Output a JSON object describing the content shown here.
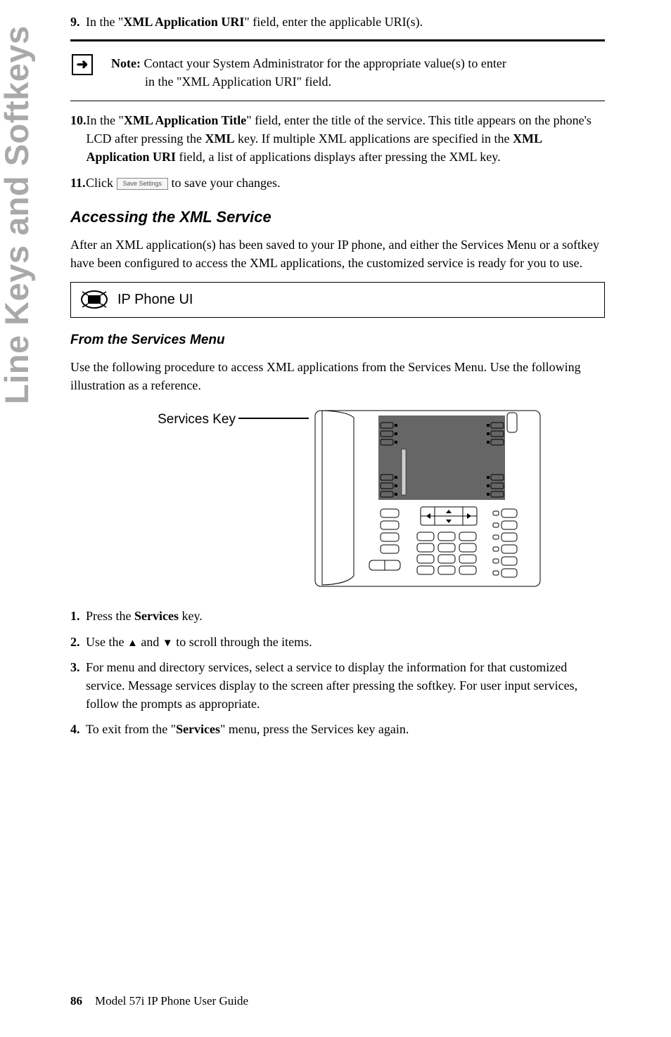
{
  "sidebar": "Line Keys and Softkeys",
  "step9": {
    "num": "9.",
    "text_pre": "In the \"",
    "bold1": "XML Application URI",
    "text_post": "\" field, enter the applicable URI(s)."
  },
  "note": {
    "label": "Note:",
    "line1": " Contact your System Administrator for the appropriate value(s) to enter",
    "line2": "in the \"XML Application URI\" field."
  },
  "step10": {
    "num": "10.",
    "t1": "In the \"",
    "b1": "XML Application Title",
    "t2": "\" field, enter the title of the service. This title appears on the phone's LCD after pressing the ",
    "b2": "XML",
    "t3": " key. If multiple XML applications are specified in the ",
    "b3": "XML Application URI",
    "t4": " field, a list of applications displays after pressing the XML key."
  },
  "step11": {
    "num": "11.",
    "t1": "Click ",
    "btn": "Save Settings",
    "t2": " to save your changes."
  },
  "h_access": "Accessing the XML Service",
  "p_access": "After an XML application(s) has been saved to your IP phone, and either the Services Menu or a softkey have been configured to access the XML applications, the customized service is ready for you to use.",
  "ui_box": "IP Phone UI",
  "h_services": "From the Services Menu",
  "p_services": "Use the following procedure to access XML applications from the Services Menu. Use the following illustration as a reference.",
  "fig_label": "Services Key",
  "list": {
    "i1": {
      "num": "1.",
      "t1": "Press the ",
      "b1": "Services",
      "t2": " key."
    },
    "i2": {
      "num": "2.",
      "t1": "Use the ",
      "t2": " and ",
      "t3": " to scroll through the items."
    },
    "i3": {
      "num": "3.",
      "t1": "For menu and directory services, select a service to display the information for that customized service. Message services display to the screen after pressing the softkey. For user input services, follow the prompts as appropriate."
    },
    "i4": {
      "num": "4.",
      "t1": "To exit from the \"",
      "b1": "Services",
      "t2": "\" menu, press the Services key again."
    }
  },
  "footer": {
    "page": "86",
    "title": "Model 57i IP Phone User Guide"
  }
}
